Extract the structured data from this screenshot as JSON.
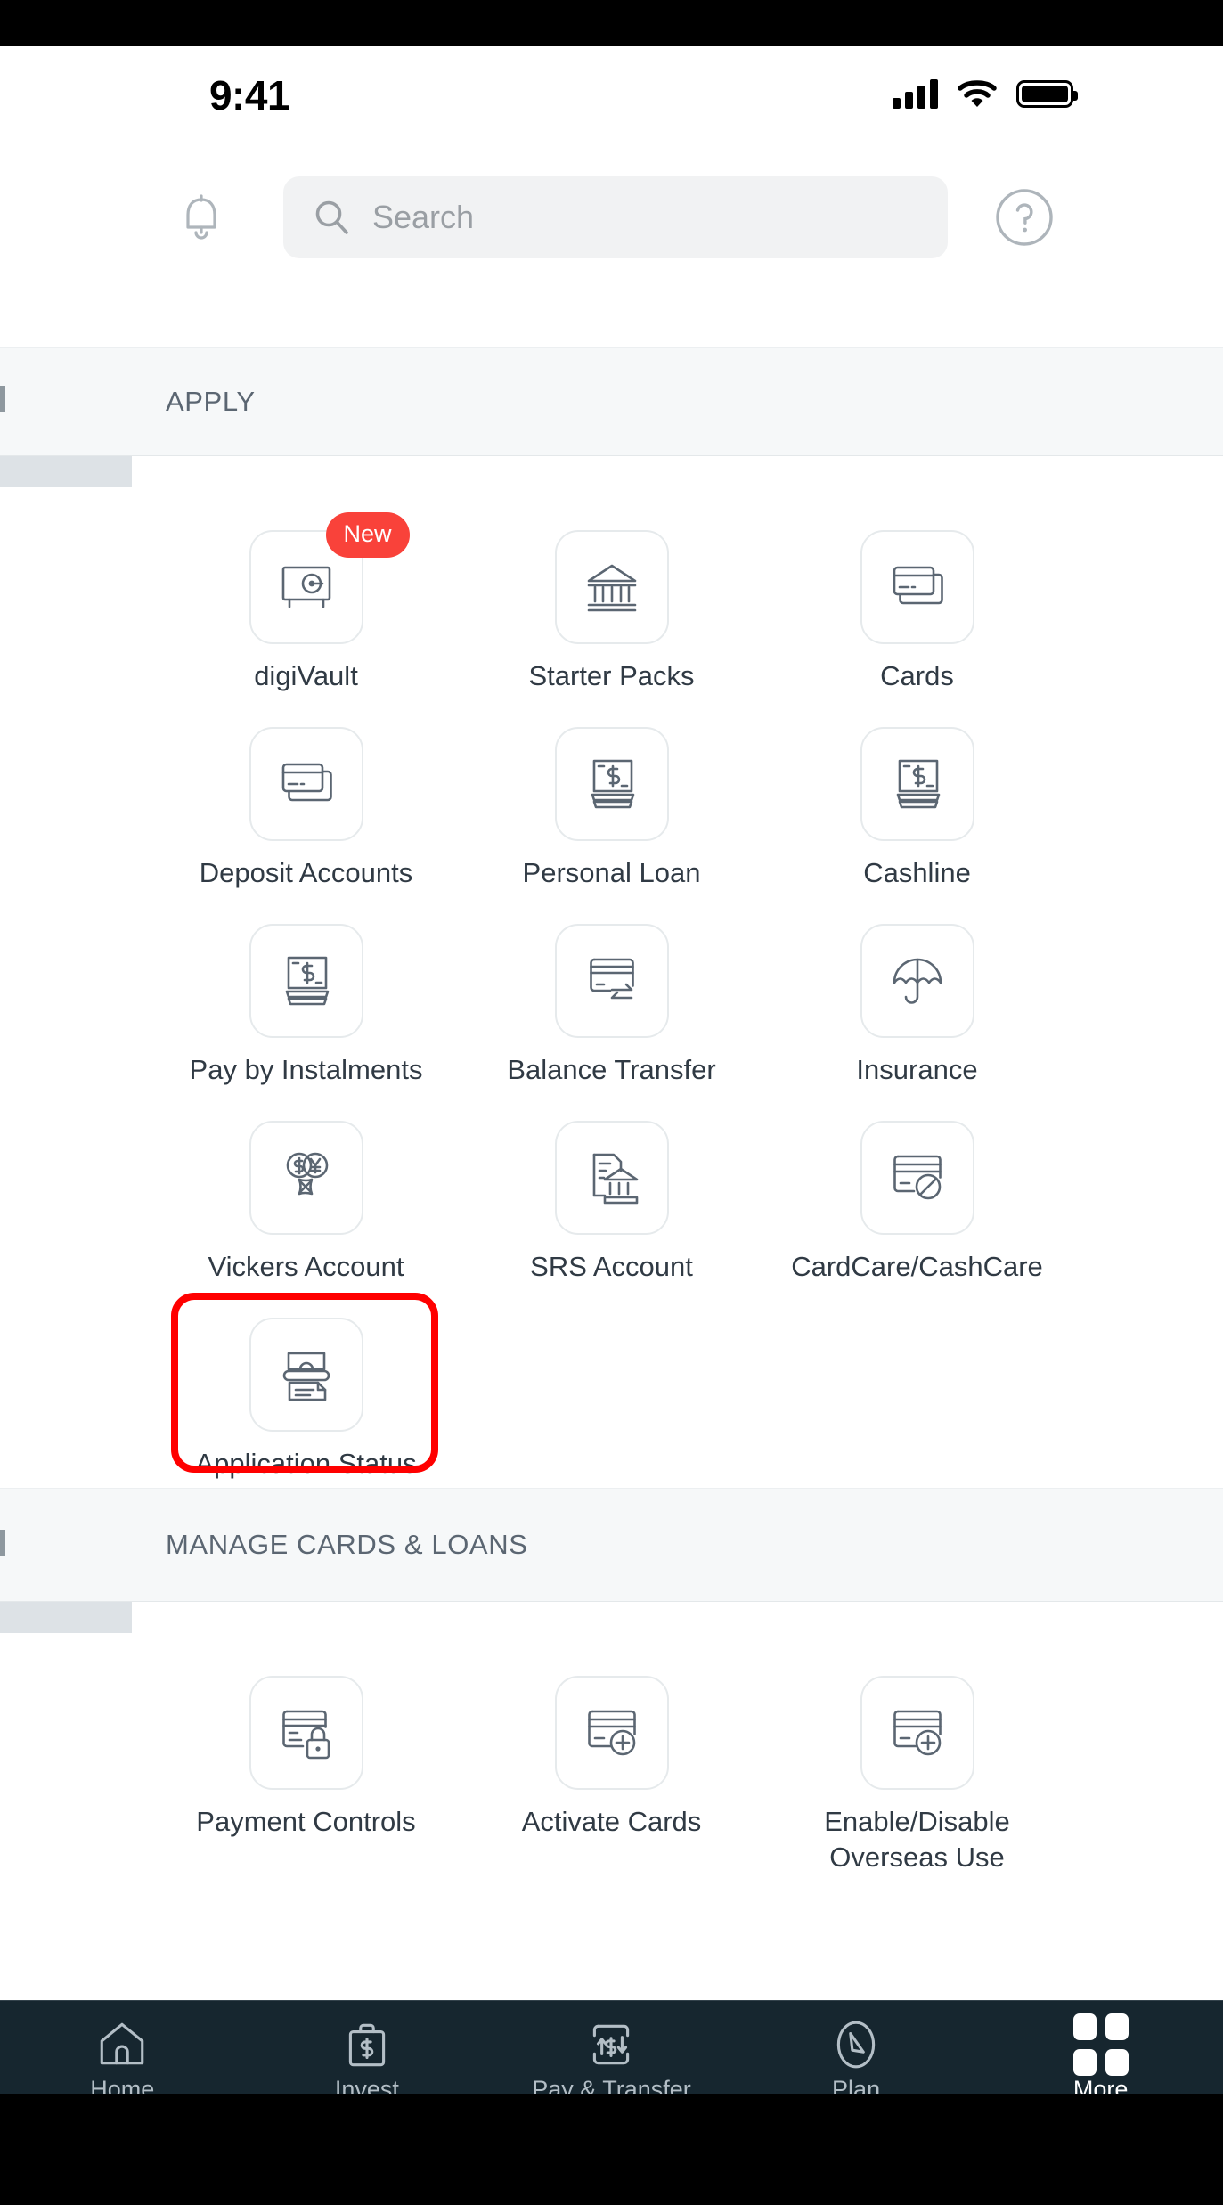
{
  "status_bar": {
    "time": "9:41",
    "cellular_icon": "signal-bars-icon",
    "wifi_icon": "wifi-icon",
    "battery_icon": "battery-full-icon"
  },
  "header": {
    "notifications_icon": "bell-icon",
    "search": {
      "icon": "search-icon",
      "placeholder": "Search",
      "value": ""
    },
    "help_icon": "help-circle-icon"
  },
  "sections": [
    {
      "id": "apply",
      "title": "APPLY",
      "rows": [
        [
          {
            "label": "digiVault",
            "icon": "vault-icon",
            "badge": "New",
            "highlighted": false
          },
          {
            "label": "Starter Packs",
            "icon": "bank-building-icon",
            "badge": null,
            "highlighted": false
          },
          {
            "label": "Cards",
            "icon": "credit-cards-stack-icon",
            "badge": null,
            "highlighted": false
          }
        ],
        [
          {
            "label": "Deposit Accounts",
            "icon": "credit-cards-stack-icon",
            "badge": null,
            "highlighted": false
          },
          {
            "label": "Personal Loan",
            "icon": "cash-stack-dollar-icon",
            "badge": null,
            "highlighted": false
          },
          {
            "label": "Cashline",
            "icon": "cash-stack-dollar-icon",
            "badge": null,
            "highlighted": false
          }
        ],
        [
          {
            "label": "Pay by Instalments",
            "icon": "cash-stack-dollar-icon",
            "badge": null,
            "highlighted": false
          },
          {
            "label": "Balance Transfer",
            "icon": "card-transfer-arrows-icon",
            "badge": null,
            "highlighted": false
          },
          {
            "label": "Insurance",
            "icon": "umbrella-icon",
            "badge": null,
            "highlighted": false
          }
        ],
        [
          {
            "label": "Vickers Account",
            "icon": "currency-exchange-icon",
            "badge": null,
            "highlighted": false
          },
          {
            "label": "SRS Account",
            "icon": "document-bank-icon",
            "badge": null,
            "highlighted": false
          },
          {
            "label": "CardCare/CashCare",
            "icon": "card-blocked-icon",
            "badge": null,
            "highlighted": false
          }
        ],
        [
          {
            "label": "Application Status",
            "icon": "document-status-icon",
            "badge": null,
            "highlighted": true
          }
        ]
      ]
    },
    {
      "id": "manage-cards-loans",
      "title": "MANAGE CARDS & LOANS",
      "rows": [
        [
          {
            "label": "Payment Controls",
            "icon": "card-lock-icon",
            "badge": null,
            "highlighted": false
          },
          {
            "label": "Activate Cards",
            "icon": "card-plus-icon",
            "badge": null,
            "highlighted": false
          },
          {
            "label": "Enable/Disable\nOverseas Use",
            "icon": "card-plus-icon",
            "badge": null,
            "highlighted": false
          }
        ]
      ]
    }
  ],
  "bottom_nav": {
    "items": [
      {
        "label": "Home",
        "icon": "home-icon",
        "active": false
      },
      {
        "label": "Invest",
        "icon": "briefcase-dollar-icon",
        "active": false
      },
      {
        "label": "Pay & Transfer",
        "icon": "transfer-dollar-icon",
        "active": false
      },
      {
        "label": "Plan",
        "icon": "compass-arrow-icon",
        "active": false
      },
      {
        "label": "More",
        "icon": "grid-four-squares-icon",
        "active": true
      }
    ]
  },
  "colors": {
    "badge_red": "#f9423a",
    "highlight_red": "#ff0000",
    "nav_background": "#16262f",
    "icon_stroke": "#5b6672",
    "section_header_bg": "#f6f8f9",
    "search_bg": "#f1f2f3"
  }
}
